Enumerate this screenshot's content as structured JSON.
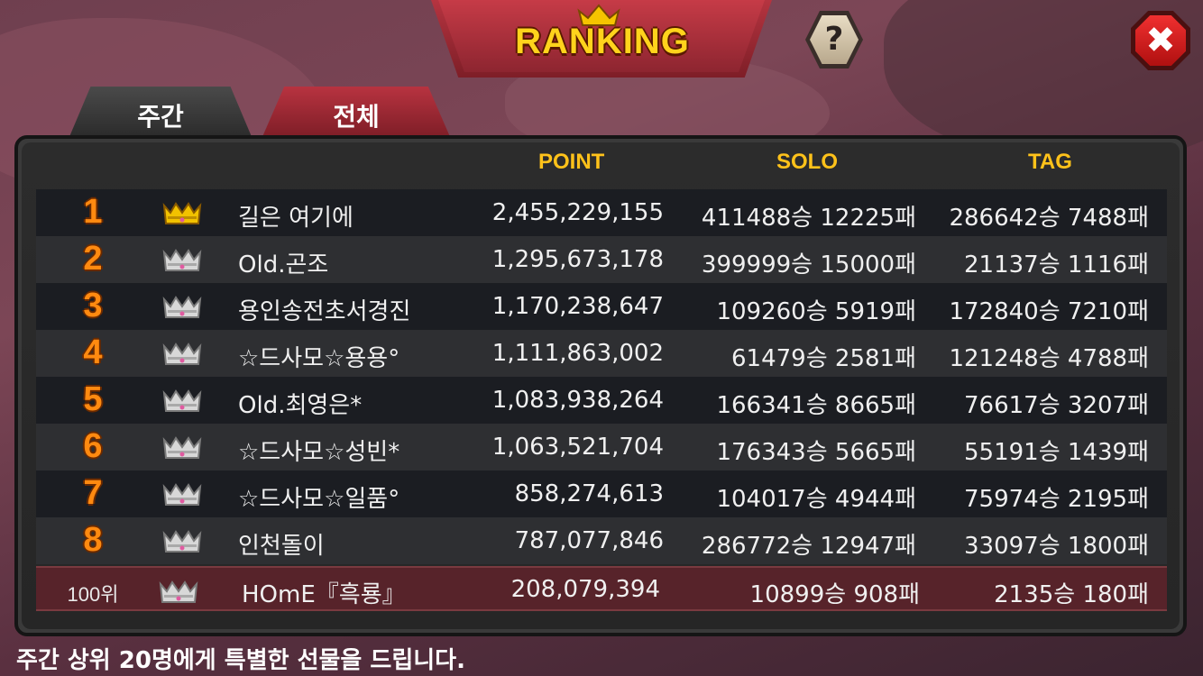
{
  "header": {
    "title": "RANKING",
    "help_icon": "question-mark-icon",
    "help_glyph": "?",
    "close_icon": "close-icon",
    "close_glyph": "✖"
  },
  "tabs": [
    {
      "label": "주간",
      "active": true
    },
    {
      "label": "전체",
      "active": false
    }
  ],
  "columns": {
    "point": "POINT",
    "solo": "SOLO",
    "tag": "TAG"
  },
  "colors": {
    "accent": "#ffc21a",
    "rank": "#ff8a10",
    "my_row": "#57232a",
    "gold_crown": "#f2c200",
    "silver_crown": "#d8d8d8"
  },
  "rows": [
    {
      "rank": "1",
      "crown": "gold",
      "name": "길은 여기에",
      "point": "2,455,229,155",
      "solo": "411488승 12225패",
      "tag": "286642승 7488패"
    },
    {
      "rank": "2",
      "crown": "silver",
      "name": "Old.곤조",
      "point": "1,295,673,178",
      "solo": "399999승 15000패",
      "tag": "21137승 1116패"
    },
    {
      "rank": "3",
      "crown": "silver",
      "name": "용인송전초서경진",
      "point": "1,170,238,647",
      "solo": "109260승 5919패",
      "tag": "172840승 7210패"
    },
    {
      "rank": "4",
      "crown": "silver",
      "name": "☆드사모☆용용°",
      "point": "1,111,863,002",
      "solo": "61479승 2581패",
      "tag": "121248승 4788패"
    },
    {
      "rank": "5",
      "crown": "silver",
      "name": "Old.최영은*",
      "point": "1,083,938,264",
      "solo": "166341승 8665패",
      "tag": "76617승 3207패"
    },
    {
      "rank": "6",
      "crown": "silver",
      "name": "☆드사모☆성빈*",
      "point": "1,063,521,704",
      "solo": "176343승 5665패",
      "tag": "55191승 1439패"
    },
    {
      "rank": "7",
      "crown": "silver",
      "name": "☆드사모☆일품°",
      "point": "858,274,613",
      "solo": "104017승 4944패",
      "tag": "75974승 2195패"
    },
    {
      "rank": "8",
      "crown": "silver",
      "name": "인천돌이",
      "point": "787,077,846",
      "solo": "286772승 12947패",
      "tag": "33097승 1800패"
    }
  ],
  "my_row": {
    "rank": "100위",
    "crown": "silver",
    "name": "HOmE『흑룡』",
    "point": "208,079,394",
    "solo": "10899승 908패",
    "tag": "2135승 180패"
  },
  "footer": {
    "text": "주간 상위 20명에게 특별한 선물을 드립니다."
  }
}
